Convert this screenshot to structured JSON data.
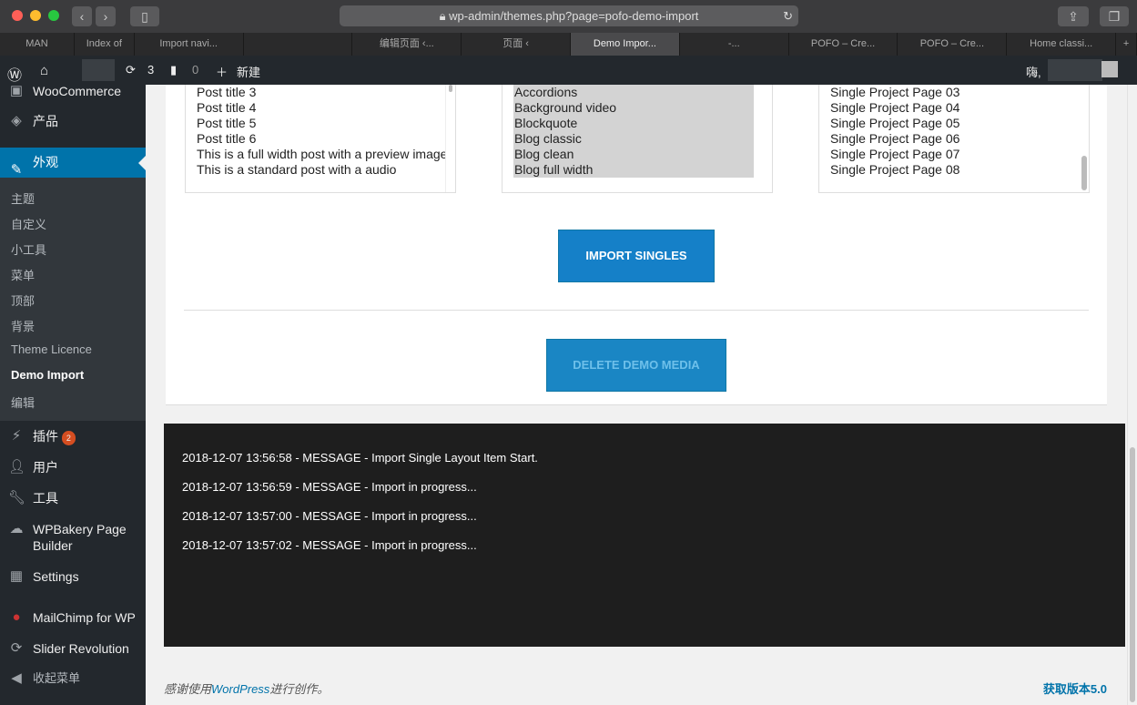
{
  "browser": {
    "url": "wp-admin/themes.php?page=pofo-demo-import",
    "tabs": [
      "MAN",
      "Index of",
      "Import navi...",
      "",
      "编辑页面 ‹...",
      "页面 ‹",
      "Demo Impor...",
      "-...",
      "POFO – Cre...",
      "POFO – Cre...",
      "Home classi..."
    ],
    "active_tab": 6
  },
  "adminbar": {
    "updates": "3",
    "comments": "0",
    "new": "新建",
    "greeting": "嗨,"
  },
  "sidebar": {
    "items": [
      "WooCommerce",
      "产品",
      "外观",
      "插件",
      "用户",
      "工具",
      "WPBakery Page Builder",
      "Settings",
      "MailChimp for WP",
      "Slider Revolution",
      "收起菜单"
    ],
    "plugins_badge": "2",
    "submenu": [
      "主题",
      "自定义",
      "小工具",
      "菜单",
      "顶部",
      "背景",
      "Theme Licence",
      "Demo Import",
      "编辑"
    ]
  },
  "lists": {
    "posts": [
      "Post title 3",
      "Post title 4",
      "Post title 5",
      "Post title 6",
      "This is a full width post with a preview image",
      "This is a standard post with a audio"
    ],
    "elements": [
      "Accordions",
      "Background video",
      "Blockquote",
      "Blog classic",
      "Blog clean",
      "Blog full width"
    ],
    "projects": [
      "Single Project Page 03",
      "Single Project Page 04",
      "Single Project Page 05",
      "Single Project Page 06",
      "Single Project Page 07",
      "Single Project Page 08"
    ]
  },
  "buttons": {
    "import_singles": "IMPORT SINGLES",
    "delete_demo_media": "DELETE DEMO MEDIA"
  },
  "log": [
    "2018-12-07 13:56:58 - MESSAGE - Import Single Layout Item Start.",
    "2018-12-07 13:56:59 - MESSAGE - Import in progress...",
    "2018-12-07 13:57:00 - MESSAGE - Import in progress...",
    "2018-12-07 13:57:02 - MESSAGE - Import in progress..."
  ],
  "footer": {
    "thanks_pre": "感谢使用",
    "wordpress": "WordPress",
    "thanks_post": "进行创作。",
    "version": "获取版本5.0"
  }
}
